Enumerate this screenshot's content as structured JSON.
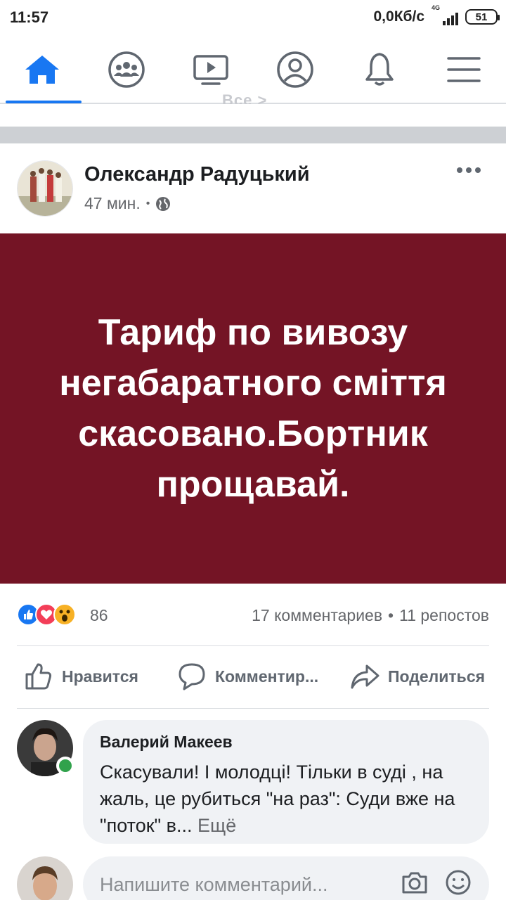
{
  "status_bar": {
    "time": "11:57",
    "speed": "0,0Кб/с",
    "network": "4G",
    "battery": "51"
  },
  "nav": {
    "items": [
      "home-icon",
      "groups-icon",
      "watch-icon",
      "profile-icon",
      "notifications-icon",
      "menu-icon"
    ],
    "active_index": 0,
    "accent_color": "#1877f2"
  },
  "ghost_text": "Все >",
  "post": {
    "author": "Олександр Радуцький",
    "time": "47 мин.",
    "meta_dot": "•",
    "privacy_icon": "globe-icon",
    "background_color": "#741425",
    "text": "Тариф по вивозу негабаратного сміття скасовано.Бортник прощавай.",
    "reactions": {
      "icons": [
        "like",
        "love",
        "wow"
      ],
      "count": "86",
      "comments": "17 комментариев",
      "separator": "•",
      "shares": "11 репостов"
    },
    "actions": {
      "like": "Нравится",
      "comment": "Комментир...",
      "share": "Поделиться"
    }
  },
  "comment": {
    "author": "Валерий Макеев",
    "text": "Скасували! І молодці! Тільки в суді , на жаль, це рубиться \"на раз\": Суди вже на \"поток\" в...",
    "more": "Ещё"
  },
  "write_comment": {
    "placeholder": "Напишите комментарий..."
  }
}
